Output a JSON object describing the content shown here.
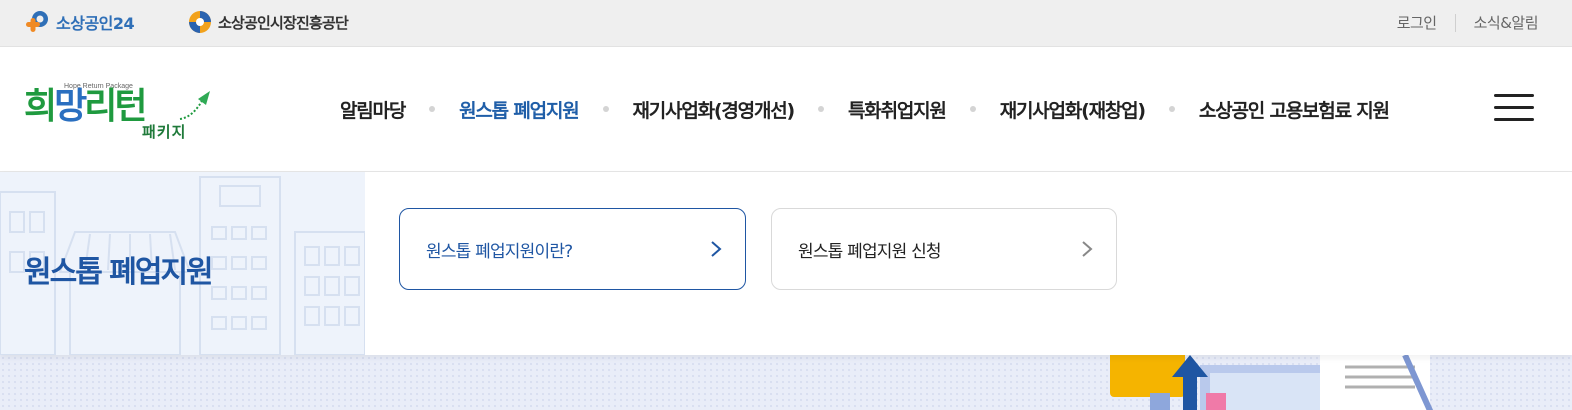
{
  "topbar": {
    "brand1_text": "소상공인24",
    "brand2_text": "소상공인시장진흥공단",
    "login": "로그인",
    "news": "소식&알림"
  },
  "header": {
    "logo_sub": "Hope Return Package",
    "logo_main_1": "희",
    "logo_main_2": "망",
    "logo_main_3": "리",
    "logo_main_4": "턴",
    "logo_pkg": "패키지",
    "gnb": [
      {
        "label": "알림마당",
        "active": false
      },
      {
        "label": "원스톱 폐업지원",
        "active": true
      },
      {
        "label": "재기사업화(경영개선)",
        "active": false
      },
      {
        "label": "특화취업지원",
        "active": false
      },
      {
        "label": "재기사업화(재창업)",
        "active": false
      },
      {
        "label": "소상공인 고용보험료 지원",
        "active": false
      }
    ]
  },
  "subpanel": {
    "title": "원스톱 폐업지원",
    "cards": [
      {
        "label": "원스톱 폐업지원이란?",
        "selected": true
      },
      {
        "label": "원스톱 폐업지원 신청",
        "selected": false
      }
    ]
  },
  "colors": {
    "primary_blue": "#1f56a3",
    "active_nav": "#1f5ea8",
    "logo_green": "#1f9a3f",
    "topbar_bg": "#efefef"
  }
}
